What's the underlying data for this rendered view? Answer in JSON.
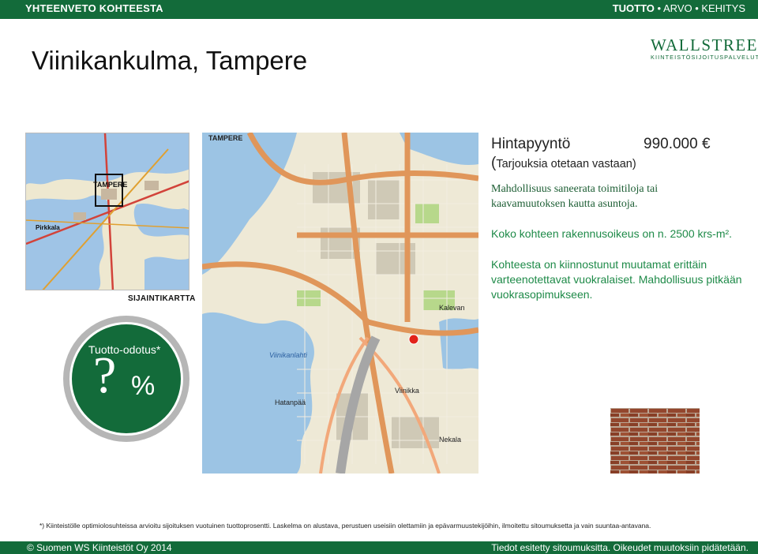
{
  "header": {
    "section": "YHTEENVETO KOHTEESTA",
    "nav_active": "TUOTTO",
    "nav_rest": "• ARVO • KEHITYS"
  },
  "title": "Viinikankulma, Tampere",
  "logo": {
    "name": "WALLSTREET",
    "registered": "©",
    "tagline": "KIINTEISTÖSIJOITUSPALVELUT",
    "color": "#136b3a"
  },
  "maps": {
    "location_label": "SIJAINTIKARTTA",
    "mini_labels": [
      "TAMPERE",
      "Pirkkala"
    ],
    "main_labels": [
      "TAMPERE",
      "Viinikka",
      "Hatanpää",
      "Kalevan",
      "Viinikanlahti",
      "Nekala"
    ]
  },
  "price": {
    "label": "Hintapyyntö",
    "value": "990.000 €",
    "open_paren": "(",
    "note": "Tarjouksia otetaan vastaan)"
  },
  "info": {
    "line1": "Mahdollisuus saneerata toimitiloja tai kaavamuutoksen kautta asuntoja.",
    "line2": "Koko kohteen rakennusoikeus on n. 2500 krs-m².",
    "line3": "Kohteesta on kiinnostunut muutamat erittäin varteenotettavat vuokralaiset. Mahdollisuus pitkään vuokrasopimukseen."
  },
  "yield_badge": {
    "label": "Tuotto-odotus*",
    "value": "?",
    "unit": "%"
  },
  "footnote": "*) Kiinteistölle optimiolosuhteissa arvioitu sijoituksen vuotuinen tuottoprosentti. Laskelma on alustava, perustuen useisiin olettamiin ja epävarmuustekijöihin, ilmoitettu sitoumuksetta ja vain suuntaa-antavana.",
  "footer": {
    "copyright": "© Suomen WS Kiinteistöt Oy 2014",
    "disclaimer": "Tiedot esitetty sitoumuksitta. Oikeudet muutoksiin pidätetään."
  },
  "colors": {
    "brand_green": "#136b3a",
    "text_green": "#1e8a48",
    "badge_ring": "#b6b6b6"
  }
}
